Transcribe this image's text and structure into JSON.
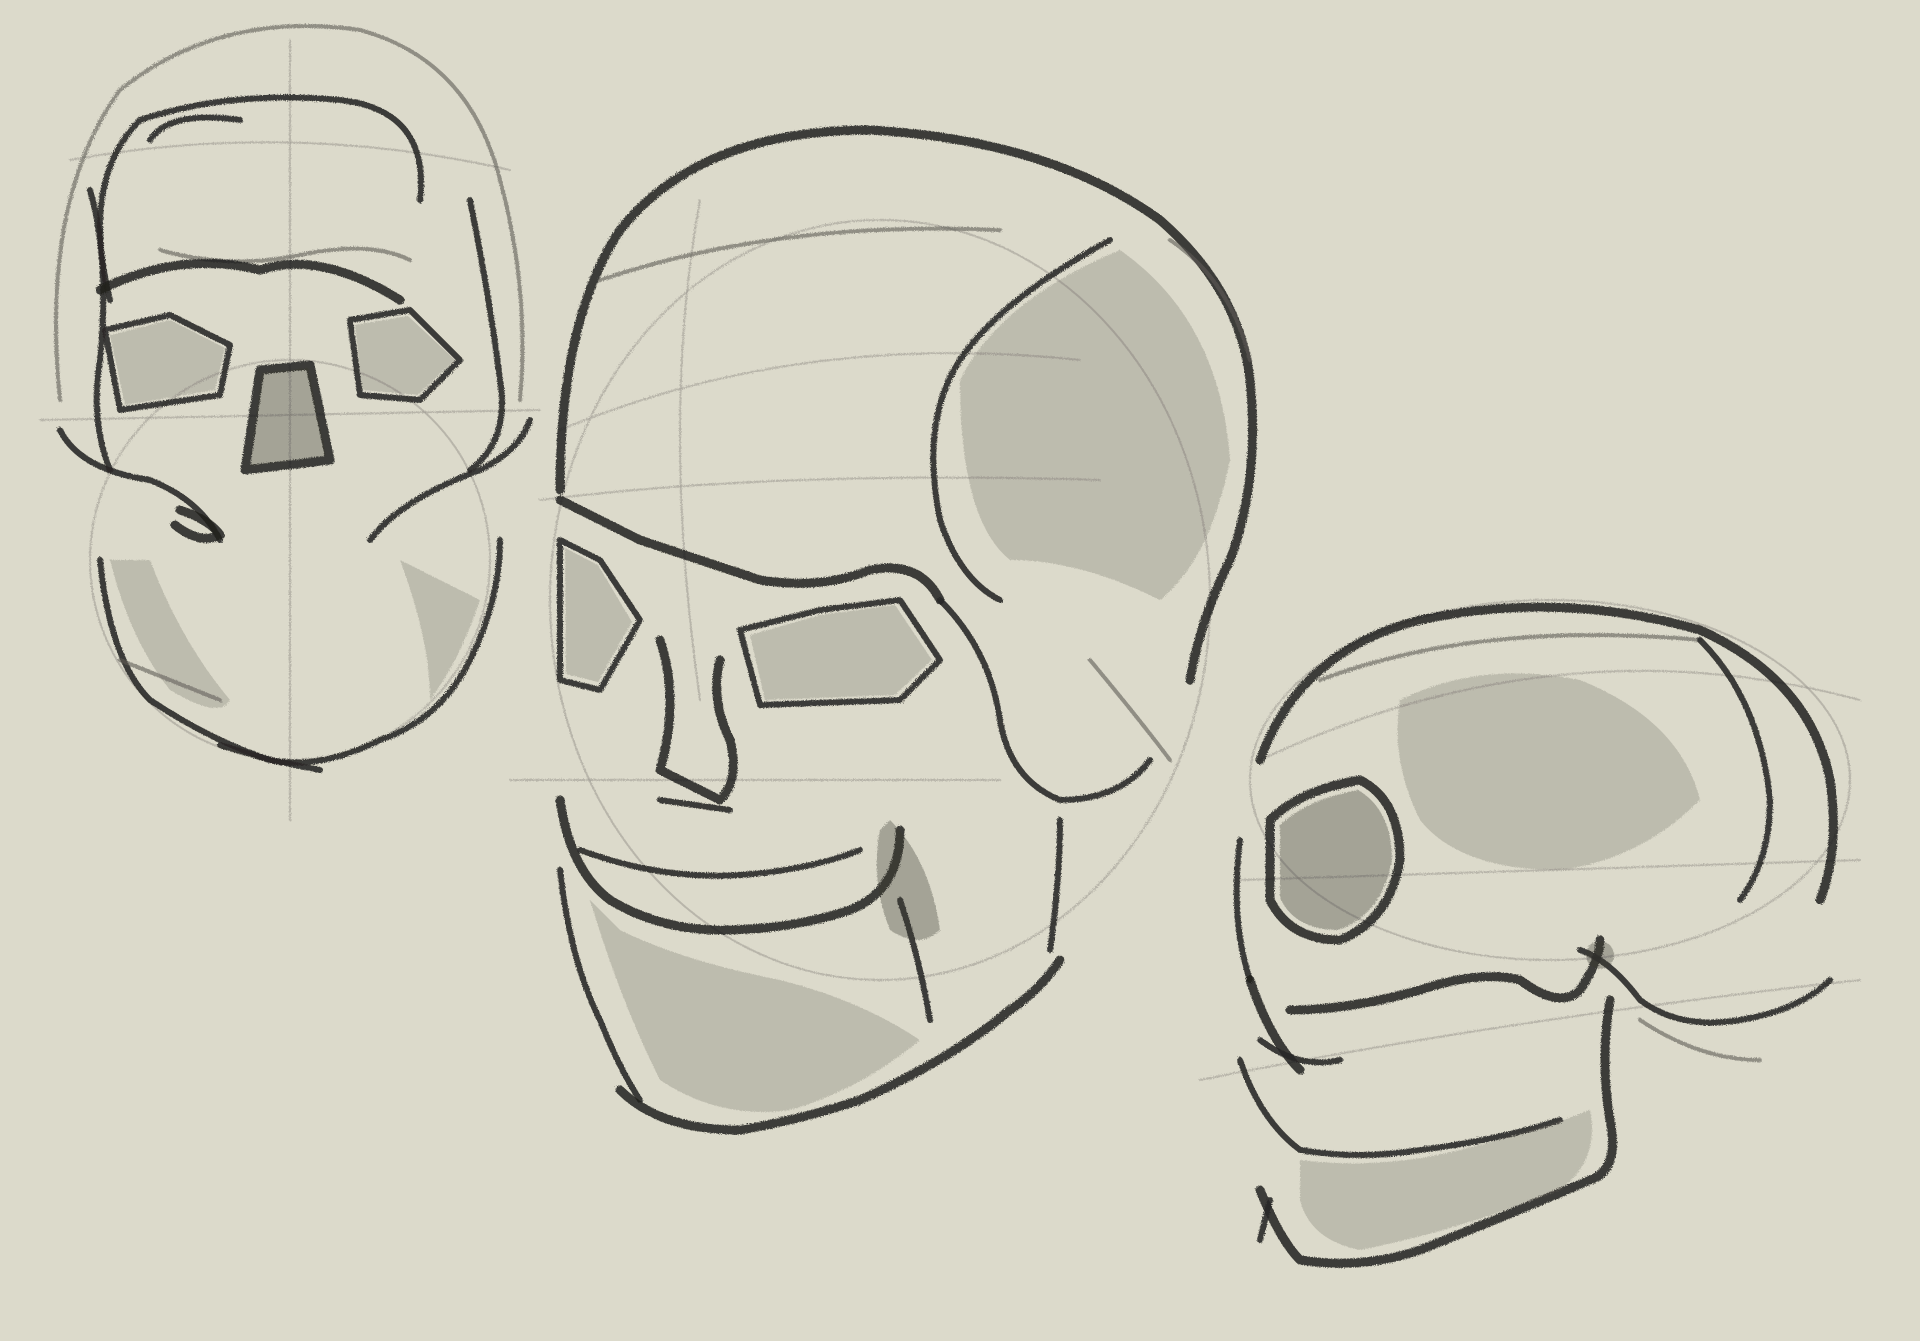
{
  "canvas": {
    "background": "#dcdacb",
    "stroke_color": "#2a2927"
  },
  "sketches": [
    {
      "name": "skull-front-view"
    },
    {
      "name": "skull-three-quarter-view"
    },
    {
      "name": "skull-side-tilted-view"
    }
  ]
}
